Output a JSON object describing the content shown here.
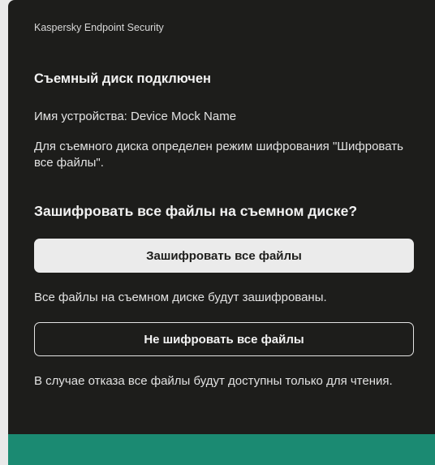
{
  "window": {
    "app_title": "Kaspersky Endpoint Security"
  },
  "dialog": {
    "heading": "Съемный диск подключен",
    "device_line": "Имя устройства: Device Mock Name",
    "mode_text": "Для съемного диска определен режим шифрования \"Шифровать все файлы\".",
    "question": "Зашифровать все файлы на съемном диске?",
    "encrypt_button": "Зашифровать все файлы",
    "encrypt_note": "Все файлы на съемном диске будут зашифрованы.",
    "skip_button": "Не шифровать все файлы",
    "skip_note": "В случае отказа все файлы будут доступны только для чтения."
  },
  "colors": {
    "background": "#1d1d1b",
    "primary_button": "#ebebeb",
    "footer_accent": "#1b8a72"
  }
}
